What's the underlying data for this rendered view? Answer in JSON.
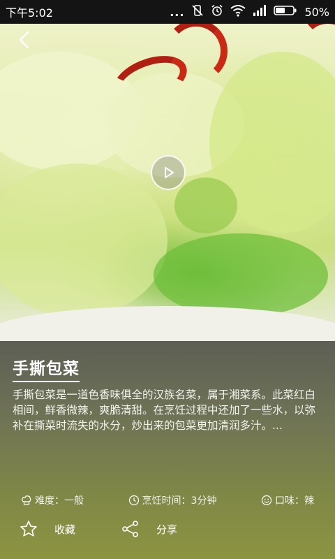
{
  "status_bar": {
    "time": "下午5:02",
    "dots": "...",
    "battery": "50%"
  },
  "hero": {
    "back_icon": "back-chevron-icon",
    "play_icon": "play-icon"
  },
  "recipe": {
    "title": "手撕包菜",
    "description": "手撕包菜是一道色香味俱全的汉族名菜，属于湘菜系。此菜红白相间，鲜香微辣，爽脆清甜。在烹饪过程中还加了一些水，以弥补在撕菜时流失的水分，炒出来的包菜更加清润多汁。..."
  },
  "meta": {
    "difficulty": "难度：一般",
    "cook_time": "烹饪时间：3分钟",
    "taste": "口味：辣"
  },
  "actions": {
    "favorite": "收藏",
    "share": "分享"
  }
}
